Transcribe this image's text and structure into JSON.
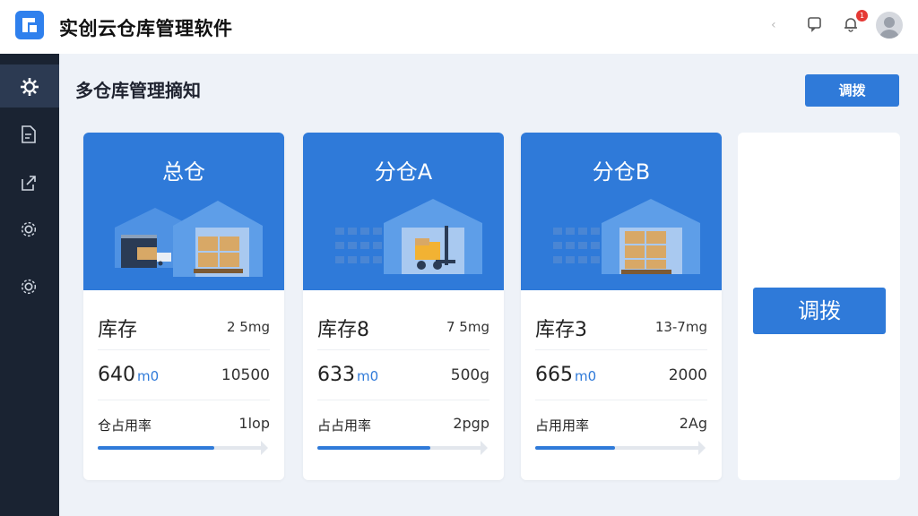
{
  "header": {
    "app_title": "实创云仓库管理软件",
    "notification_count": "1"
  },
  "sidebar": {
    "items": [
      {
        "icon": "gear-icon",
        "active": true
      },
      {
        "icon": "document-icon",
        "active": false
      },
      {
        "icon": "share-icon",
        "active": false
      },
      {
        "icon": "settings-icon",
        "active": false
      },
      {
        "icon": "settings-icon",
        "active": false
      }
    ]
  },
  "main": {
    "page_title": "多仓库管理摘知",
    "top_button_label": "调拨",
    "big_button_label": "调拨",
    "cards": [
      {
        "title": "总仓",
        "row1_label": "库存",
        "row1_value": "2 5mg",
        "row2_value": "640",
        "row2_unit": "m0",
        "row2_right": "10500",
        "row3_label": "仓占用率",
        "row3_value": "1lop",
        "progress": 0.7
      },
      {
        "title": "分仓A",
        "row1_label": "库存8",
        "row1_value": "7 5mg",
        "row2_value": "633",
        "row2_unit": "m0",
        "row2_right": "500g",
        "row3_label": "占占用率",
        "row3_value": "2pgp",
        "progress": 0.68
      },
      {
        "title": "分仓B",
        "row1_label": "库存3",
        "row1_value": "13-7mg",
        "row2_value": "665",
        "row2_unit": "m0",
        "row2_right": "2000",
        "row3_label": "占用用率",
        "row3_value": "2Ag",
        "progress": 0.48
      }
    ]
  },
  "colors": {
    "primary": "#2f7ad9",
    "sidebar_bg": "#1a2332",
    "page_bg": "#eef2f8"
  }
}
